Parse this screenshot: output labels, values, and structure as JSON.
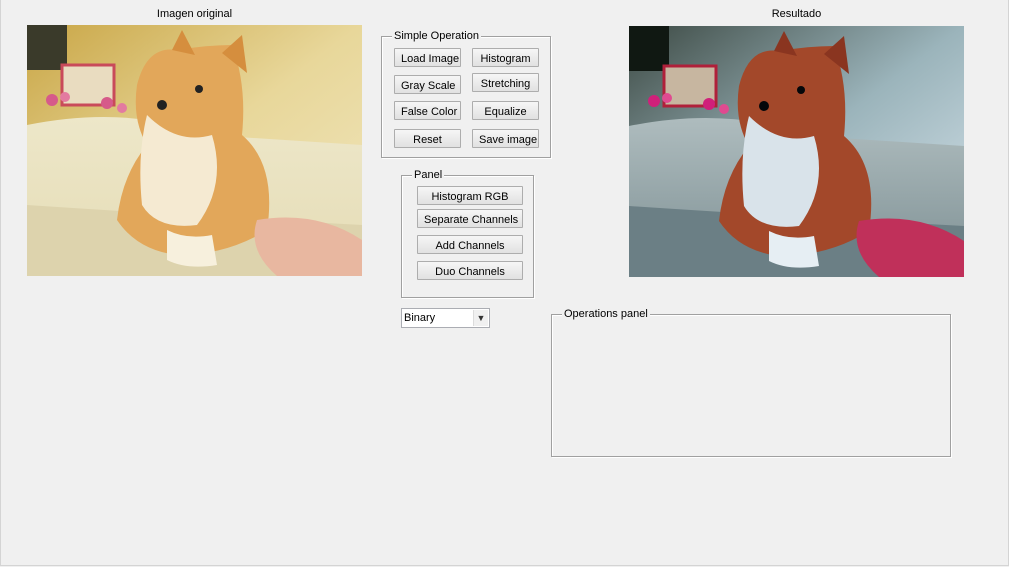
{
  "left_image": {
    "title": "Imagen original"
  },
  "right_image": {
    "title": "Resultado"
  },
  "simple_operation": {
    "label": "Simple Operation",
    "buttons": {
      "load_image": "Load Image",
      "histogram": "Histogram",
      "gray_scale": "Gray Scale",
      "stretching": "Stretching",
      "false_color": "False Color",
      "equalize": "Equalize",
      "reset": "Reset",
      "save_image": "Save image"
    }
  },
  "panel": {
    "label": "Panel",
    "buttons": {
      "histogram_rgb": "Histogram RGB",
      "separate_channels": "Separate Channels",
      "add_channels": "Add Channels",
      "duo_channels": "Duo Channels"
    }
  },
  "dropdown": {
    "selected": "Binary",
    "icon": "chevron-down-icon"
  },
  "operations_panel": {
    "label": "Operations panel"
  },
  "colors": {
    "background": "#f0f0f0",
    "group_border": "#a0a0a0"
  }
}
